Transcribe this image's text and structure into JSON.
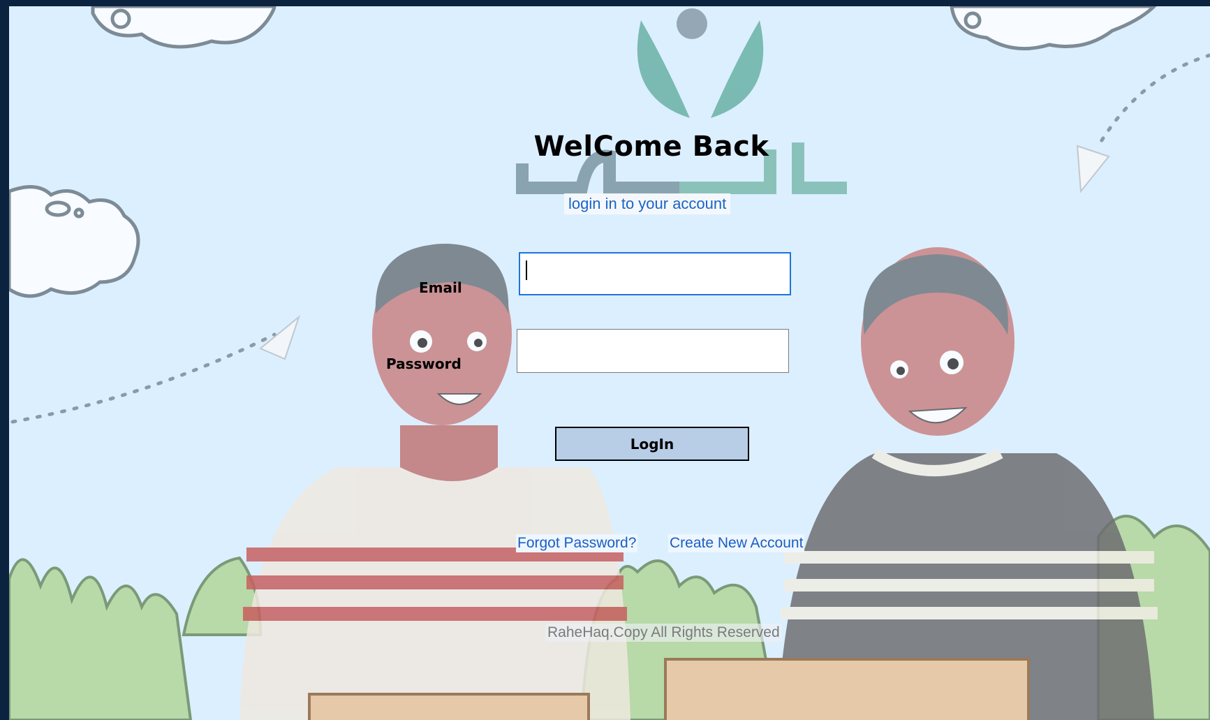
{
  "page": {
    "title": "WelCome Back",
    "subtitle": "login in to your  account"
  },
  "form": {
    "email_label": "Email",
    "email_value": "",
    "password_label": "Password",
    "password_value": "",
    "login_label": "LogIn"
  },
  "links": {
    "forgot_password": "Forgot Password?",
    "create_account": "Create New Account"
  },
  "footer": {
    "text": "RaheHaq.Copy All Rights  Reserved"
  },
  "colors": {
    "background": "#dcefff",
    "link": "#1a5fc4",
    "button": "#b8cde6",
    "focus_border": "#1d74d8",
    "frame": "#0c2340"
  },
  "icons": {
    "logo": "rahehaq-logo",
    "background_art": "two-boys-illustration"
  }
}
